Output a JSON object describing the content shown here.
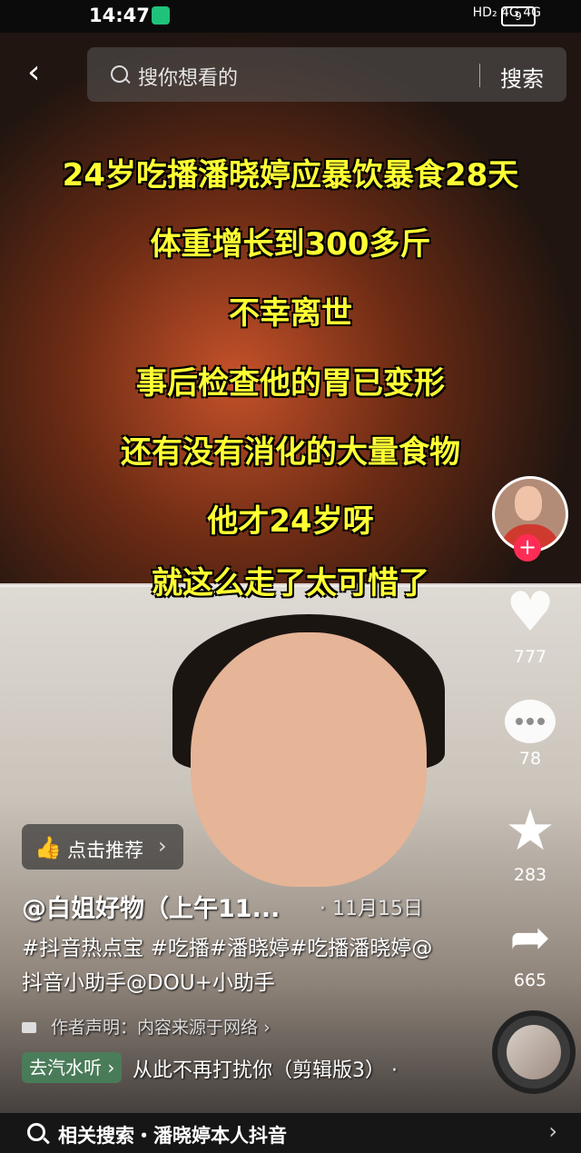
{
  "status_bar": {
    "time": "14:47",
    "network": "HD₂ 4G 4G",
    "battery": "9"
  },
  "topbar": {
    "search_placeholder": "搜你想看的",
    "search_button": "搜索"
  },
  "captions": [
    "24岁吃播潘晓婷应暴饮暴食28天",
    "体重增长到300多斤",
    "不幸离世",
    "事后检查他的胃已变形",
    "还有没有消化的大量食物",
    "他才24岁呀",
    "就这么走了太可惜了"
  ],
  "actions": {
    "likes": "777",
    "comments": "78",
    "favorites": "283",
    "shares": "665"
  },
  "recommend": {
    "label": "点击推荐"
  },
  "post": {
    "author": "@白姐好物（上午11...",
    "date": "· 11月15日",
    "description": "#抖音热点宝 #吃播#潘晓婷#吃播潘晓婷@抖音小助手@DOU+小助手",
    "declaration": "作者声明：内容来源于网络 ›"
  },
  "music": {
    "tag": "去汽水听 ›",
    "title": "从此不再打扰你（剪辑版3）  ·"
  },
  "bottom_bar": {
    "related_search": "相关搜索・潘晓婷本人抖音"
  },
  "colors": {
    "caption": "#ffff33",
    "follow": "#ff2c55"
  }
}
